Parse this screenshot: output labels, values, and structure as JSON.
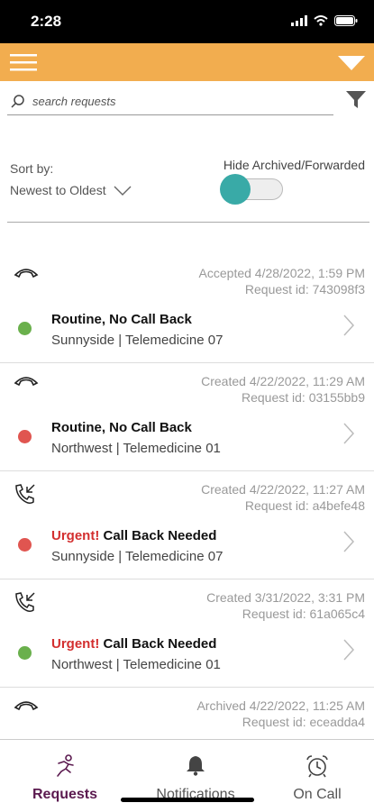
{
  "status_bar": {
    "time": "2:28",
    "icons": [
      "signal-icon",
      "wifi-icon",
      "battery-icon"
    ]
  },
  "app_bar": {
    "color": "#f2ad4f",
    "icons": [
      "hamburger-menu-icon",
      "dropdown-triangle-icon"
    ]
  },
  "search": {
    "placeholder": "search requests",
    "value": "",
    "icons": [
      "search-icon",
      "filter-icon"
    ]
  },
  "sort": {
    "label": "Sort by:",
    "value": "Newest to Oldest"
  },
  "hide_toggle": {
    "label": "Hide Archived/Forwarded",
    "on": false,
    "knob_color": "#39aaa7"
  },
  "requests": [
    {
      "phone_icon": "hangup-phone-icon",
      "status_line": "Accepted 4/28/2022, 1:59 PM",
      "request_id_line": "Request id: 743098f3",
      "status_color": "#6ab04c",
      "urgent_label": "",
      "title": "Routine, No Call Back",
      "subtitle": "Sunnyside | Telemedicine 07"
    },
    {
      "phone_icon": "hangup-phone-icon",
      "status_line": "Created 4/22/2022, 11:29 AM",
      "request_id_line": "Request id: 03155bb9",
      "status_color": "#e05550",
      "urgent_label": "",
      "title": "Routine, No Call Back",
      "subtitle": "Northwest | Telemedicine 01"
    },
    {
      "phone_icon": "incoming-call-icon",
      "status_line": "Created 4/22/2022, 11:27 AM",
      "request_id_line": "Request id: a4befe48",
      "status_color": "#e05550",
      "urgent_label": "Urgent!",
      "title": "Call Back Needed",
      "subtitle": "Sunnyside | Telemedicine 07"
    },
    {
      "phone_icon": "incoming-call-icon",
      "status_line": "Created 3/31/2022, 3:31 PM",
      "request_id_line": "Request id: 61a065c4",
      "status_color": "#6ab04c",
      "urgent_label": "Urgent!",
      "title": "Call Back Needed",
      "subtitle": "Northwest | Telemedicine 01"
    },
    {
      "phone_icon": "hangup-phone-icon",
      "status_line": "Archived 4/22/2022, 11:25 AM",
      "request_id_line": "Request id: eceadda4",
      "status_color": "",
      "urgent_label": "",
      "title": "",
      "subtitle": ""
    }
  ],
  "tabs": [
    {
      "label": "Requests",
      "icon": "running-person-icon",
      "active": true
    },
    {
      "label": "Notifications",
      "icon": "bell-icon",
      "active": false
    },
    {
      "label": "On Call",
      "icon": "alarm-clock-icon",
      "active": false
    }
  ],
  "colors": {
    "brand": "#f2ad4f",
    "active_tab": "#5b1a4f",
    "urgent": "#d32f2f"
  }
}
